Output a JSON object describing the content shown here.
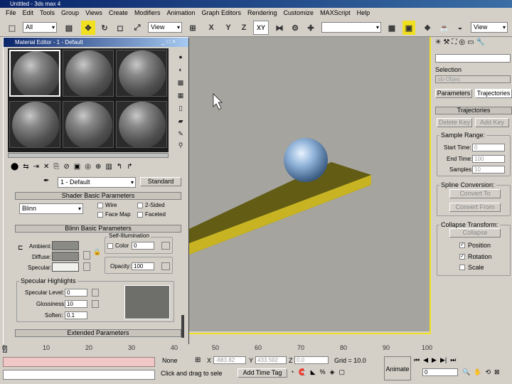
{
  "app_title": "Untitled - 3ds max 4",
  "menu": [
    "File",
    "Edit",
    "Tools",
    "Group",
    "Views",
    "Create",
    "Modifiers",
    "Animation",
    "Graph Editors",
    "Rendering",
    "Customize",
    "MAXScript",
    "Help"
  ],
  "toolbar": {
    "selection_filter": "All",
    "ref_coord": "View",
    "axis_x": "X",
    "axis_y": "Y",
    "axis_z": "Z",
    "axis_xy": "XY",
    "view_right": "View"
  },
  "material_editor": {
    "title": "Material Editor - 1 - Default",
    "material_name": "1 - Default",
    "material_type": "Standard",
    "shader_rollout": "Shader Basic Parameters",
    "shader": "Blinn",
    "checkboxes": [
      "Wire",
      "2-Sided",
      "Face Map",
      "Faceted"
    ],
    "blinn_rollout": "Blinn Basic Parameters",
    "self_illum_label": "Self-Illumination",
    "color_label": "Color",
    "color_value": "0",
    "ambient": "Ambient:",
    "diffuse": "Diffuse:",
    "specular": "Specular:",
    "opacity_label": "Opacity:",
    "opacity_value": "100",
    "spec_highlights": "Specular Highlights",
    "spec_level_label": "Specular Level:",
    "spec_level": "0",
    "glossiness_label": "Glossiness:",
    "glossiness": "10",
    "soften_label": "Soften:",
    "soften": "0.1",
    "extended_rollout": "Extended Parameters"
  },
  "command_panel": {
    "selection_label": "Selection",
    "selection_value": "ob-Objec",
    "tab_parameters": "Parameters",
    "tab_trajectories": "Trajectories",
    "rollout_trajectories": "Trajectories",
    "delete_key": "Delete Key",
    "add_key": "Add Key",
    "sample_range": "Sample Range:",
    "start_time_label": "Start Time:",
    "start_time": "0",
    "end_time_label": "End Time:",
    "end_time": "100",
    "samples_label": "Samples:",
    "samples": "10",
    "spline_conversion": "Spline Conversion:",
    "convert_to": "Convert To",
    "convert_from": "Convert From",
    "collapse_transform": "Collapse Transform:",
    "collapse": "Collapse",
    "position": "Position",
    "rotation": "Rotation",
    "scale": "Scale"
  },
  "timeline": {
    "ticks": [
      "0",
      "10",
      "20",
      "30",
      "40",
      "50",
      "60",
      "70",
      "80",
      "90",
      "100"
    ]
  },
  "status": {
    "selection": "None",
    "x_label": "X",
    "x_value": "-883.82",
    "y_label": "Y",
    "y_value": "433.592",
    "z_label": "Z",
    "z_value": "0.0",
    "grid": "Grid = 10.0",
    "prompt": "Click and drag to sele",
    "add_time_tag": "Add Time Tag",
    "animate": "Animate",
    "frame": "0"
  },
  "viewport": {
    "bg": "#a5a49f",
    "plane_color": "#6b6519",
    "sphere_color": "#8fb2d8"
  }
}
